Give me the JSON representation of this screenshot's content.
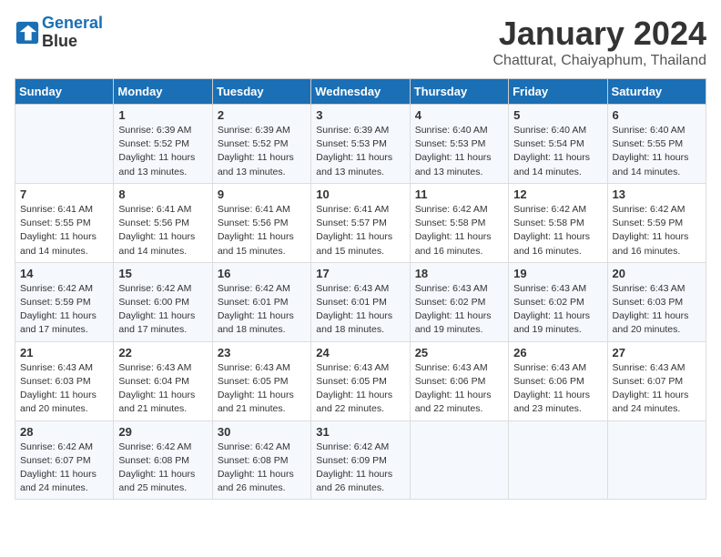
{
  "header": {
    "logo_line1": "General",
    "logo_line2": "Blue",
    "month": "January 2024",
    "location": "Chatturat, Chaiyaphum, Thailand"
  },
  "days_of_week": [
    "Sunday",
    "Monday",
    "Tuesday",
    "Wednesday",
    "Thursday",
    "Friday",
    "Saturday"
  ],
  "weeks": [
    [
      {
        "day": "",
        "lines": []
      },
      {
        "day": "1",
        "lines": [
          "Sunrise: 6:39 AM",
          "Sunset: 5:52 PM",
          "Daylight: 11 hours",
          "and 13 minutes."
        ]
      },
      {
        "day": "2",
        "lines": [
          "Sunrise: 6:39 AM",
          "Sunset: 5:52 PM",
          "Daylight: 11 hours",
          "and 13 minutes."
        ]
      },
      {
        "day": "3",
        "lines": [
          "Sunrise: 6:39 AM",
          "Sunset: 5:53 PM",
          "Daylight: 11 hours",
          "and 13 minutes."
        ]
      },
      {
        "day": "4",
        "lines": [
          "Sunrise: 6:40 AM",
          "Sunset: 5:53 PM",
          "Daylight: 11 hours",
          "and 13 minutes."
        ]
      },
      {
        "day": "5",
        "lines": [
          "Sunrise: 6:40 AM",
          "Sunset: 5:54 PM",
          "Daylight: 11 hours",
          "and 14 minutes."
        ]
      },
      {
        "day": "6",
        "lines": [
          "Sunrise: 6:40 AM",
          "Sunset: 5:55 PM",
          "Daylight: 11 hours",
          "and 14 minutes."
        ]
      }
    ],
    [
      {
        "day": "7",
        "lines": [
          "Sunrise: 6:41 AM",
          "Sunset: 5:55 PM",
          "Daylight: 11 hours",
          "and 14 minutes."
        ]
      },
      {
        "day": "8",
        "lines": [
          "Sunrise: 6:41 AM",
          "Sunset: 5:56 PM",
          "Daylight: 11 hours",
          "and 14 minutes."
        ]
      },
      {
        "day": "9",
        "lines": [
          "Sunrise: 6:41 AM",
          "Sunset: 5:56 PM",
          "Daylight: 11 hours",
          "and 15 minutes."
        ]
      },
      {
        "day": "10",
        "lines": [
          "Sunrise: 6:41 AM",
          "Sunset: 5:57 PM",
          "Daylight: 11 hours",
          "and 15 minutes."
        ]
      },
      {
        "day": "11",
        "lines": [
          "Sunrise: 6:42 AM",
          "Sunset: 5:58 PM",
          "Daylight: 11 hours",
          "and 16 minutes."
        ]
      },
      {
        "day": "12",
        "lines": [
          "Sunrise: 6:42 AM",
          "Sunset: 5:58 PM",
          "Daylight: 11 hours",
          "and 16 minutes."
        ]
      },
      {
        "day": "13",
        "lines": [
          "Sunrise: 6:42 AM",
          "Sunset: 5:59 PM",
          "Daylight: 11 hours",
          "and 16 minutes."
        ]
      }
    ],
    [
      {
        "day": "14",
        "lines": [
          "Sunrise: 6:42 AM",
          "Sunset: 5:59 PM",
          "Daylight: 11 hours",
          "and 17 minutes."
        ]
      },
      {
        "day": "15",
        "lines": [
          "Sunrise: 6:42 AM",
          "Sunset: 6:00 PM",
          "Daylight: 11 hours",
          "and 17 minutes."
        ]
      },
      {
        "day": "16",
        "lines": [
          "Sunrise: 6:42 AM",
          "Sunset: 6:01 PM",
          "Daylight: 11 hours",
          "and 18 minutes."
        ]
      },
      {
        "day": "17",
        "lines": [
          "Sunrise: 6:43 AM",
          "Sunset: 6:01 PM",
          "Daylight: 11 hours",
          "and 18 minutes."
        ]
      },
      {
        "day": "18",
        "lines": [
          "Sunrise: 6:43 AM",
          "Sunset: 6:02 PM",
          "Daylight: 11 hours",
          "and 19 minutes."
        ]
      },
      {
        "day": "19",
        "lines": [
          "Sunrise: 6:43 AM",
          "Sunset: 6:02 PM",
          "Daylight: 11 hours",
          "and 19 minutes."
        ]
      },
      {
        "day": "20",
        "lines": [
          "Sunrise: 6:43 AM",
          "Sunset: 6:03 PM",
          "Daylight: 11 hours",
          "and 20 minutes."
        ]
      }
    ],
    [
      {
        "day": "21",
        "lines": [
          "Sunrise: 6:43 AM",
          "Sunset: 6:03 PM",
          "Daylight: 11 hours",
          "and 20 minutes."
        ]
      },
      {
        "day": "22",
        "lines": [
          "Sunrise: 6:43 AM",
          "Sunset: 6:04 PM",
          "Daylight: 11 hours",
          "and 21 minutes."
        ]
      },
      {
        "day": "23",
        "lines": [
          "Sunrise: 6:43 AM",
          "Sunset: 6:05 PM",
          "Daylight: 11 hours",
          "and 21 minutes."
        ]
      },
      {
        "day": "24",
        "lines": [
          "Sunrise: 6:43 AM",
          "Sunset: 6:05 PM",
          "Daylight: 11 hours",
          "and 22 minutes."
        ]
      },
      {
        "day": "25",
        "lines": [
          "Sunrise: 6:43 AM",
          "Sunset: 6:06 PM",
          "Daylight: 11 hours",
          "and 22 minutes."
        ]
      },
      {
        "day": "26",
        "lines": [
          "Sunrise: 6:43 AM",
          "Sunset: 6:06 PM",
          "Daylight: 11 hours",
          "and 23 minutes."
        ]
      },
      {
        "day": "27",
        "lines": [
          "Sunrise: 6:43 AM",
          "Sunset: 6:07 PM",
          "Daylight: 11 hours",
          "and 24 minutes."
        ]
      }
    ],
    [
      {
        "day": "28",
        "lines": [
          "Sunrise: 6:42 AM",
          "Sunset: 6:07 PM",
          "Daylight: 11 hours",
          "and 24 minutes."
        ]
      },
      {
        "day": "29",
        "lines": [
          "Sunrise: 6:42 AM",
          "Sunset: 6:08 PM",
          "Daylight: 11 hours",
          "and 25 minutes."
        ]
      },
      {
        "day": "30",
        "lines": [
          "Sunrise: 6:42 AM",
          "Sunset: 6:08 PM",
          "Daylight: 11 hours",
          "and 26 minutes."
        ]
      },
      {
        "day": "31",
        "lines": [
          "Sunrise: 6:42 AM",
          "Sunset: 6:09 PM",
          "Daylight: 11 hours",
          "and 26 minutes."
        ]
      },
      {
        "day": "",
        "lines": []
      },
      {
        "day": "",
        "lines": []
      },
      {
        "day": "",
        "lines": []
      }
    ]
  ]
}
